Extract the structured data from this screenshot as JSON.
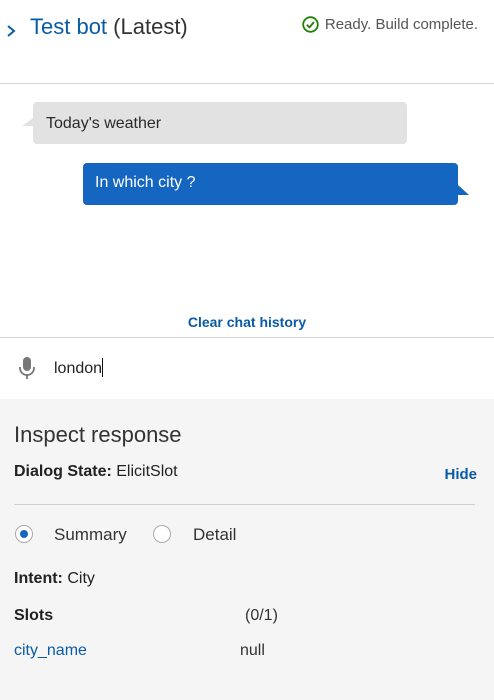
{
  "header": {
    "expand_icon": "chevron-right-icon",
    "bot_name": "Test bot",
    "version": "(Latest)",
    "status_icon": "check-circle-icon",
    "status_text": "Ready. Build complete."
  },
  "chat": {
    "messages": [
      {
        "from": "user",
        "text": "Today's weather"
      },
      {
        "from": "bot",
        "text": "In which city ?"
      }
    ],
    "clear_label": "Clear chat history"
  },
  "input": {
    "mic_icon": "microphone-icon",
    "value": "london"
  },
  "inspect": {
    "title": "Inspect response",
    "dialog_state_label": "Dialog State:",
    "dialog_state_value": "ElicitSlot",
    "hide_label": "Hide",
    "view_options": [
      {
        "label": "Summary",
        "selected": true
      },
      {
        "label": "Detail",
        "selected": false
      }
    ],
    "intent_label": "Intent:",
    "intent_value": "City",
    "slots_label": "Slots",
    "slots_count": "(0/1)",
    "slots": [
      {
        "name": "city_name",
        "value": "null"
      }
    ]
  },
  "colors": {
    "accent": "#0a5ba5",
    "bot_bubble": "#1566c0",
    "user_bubble": "#e2e2e2",
    "success": "#1d8102"
  }
}
